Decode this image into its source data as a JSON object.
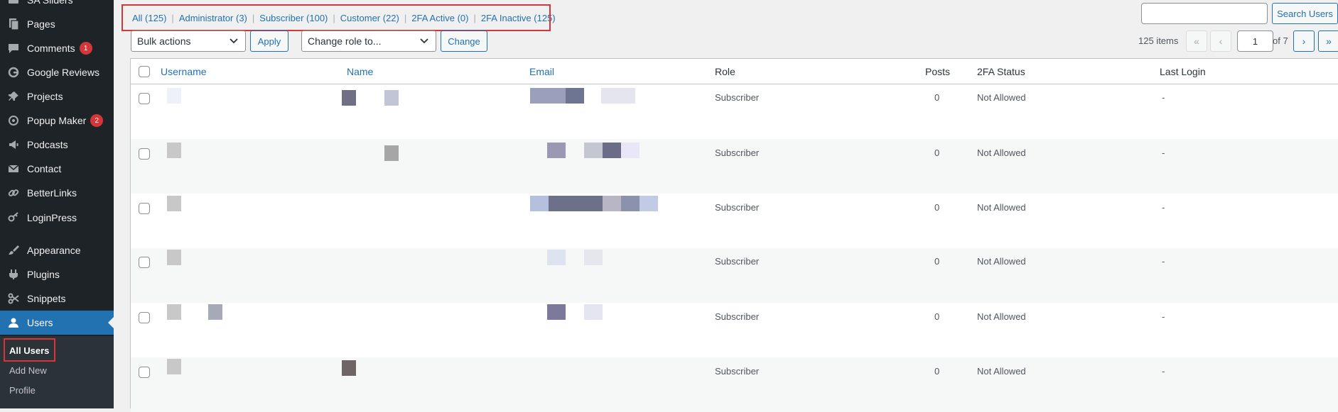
{
  "colors": {
    "sidebar_bg": "#1d2327",
    "accent": "#2271b1",
    "badge": "#d63638",
    "highlight_box": "#d63638"
  },
  "sidebar": {
    "items": [
      {
        "label": "SA Sliders",
        "icon": "slides-icon"
      },
      {
        "label": "Pages",
        "icon": "page-icon"
      },
      {
        "label": "Comments",
        "icon": "comment-icon",
        "badge": "1"
      },
      {
        "label": "Google Reviews",
        "icon": "google-icon"
      },
      {
        "label": "Projects",
        "icon": "pin-icon"
      },
      {
        "label": "Popup Maker",
        "icon": "popup-icon",
        "badge": "2"
      },
      {
        "label": "Podcasts",
        "icon": "megaphone-icon"
      },
      {
        "label": "Contact",
        "icon": "mail-icon"
      },
      {
        "label": "BetterLinks",
        "icon": "link-icon"
      },
      {
        "label": "LoginPress",
        "icon": "key-icon"
      },
      {
        "label": "Appearance",
        "icon": "brush-icon"
      },
      {
        "label": "Plugins",
        "icon": "plug-icon"
      },
      {
        "label": "Snippets",
        "icon": "scissors-icon"
      },
      {
        "label": "Users",
        "icon": "user-icon",
        "active": true
      }
    ],
    "submenu": [
      {
        "label": "All Users",
        "current": true
      },
      {
        "label": "Add New"
      },
      {
        "label": "Profile"
      }
    ]
  },
  "filters": [
    {
      "label": "All (125)"
    },
    {
      "label": "Administrator (3)"
    },
    {
      "label": "Subscriber (100)"
    },
    {
      "label": "Customer (22)"
    },
    {
      "label": "2FA Active (0)"
    },
    {
      "label": "2FA Inactive (125)"
    }
  ],
  "search": {
    "value": "",
    "button": "Search Users"
  },
  "bulk": {
    "selected": "Bulk actions",
    "apply": "Apply"
  },
  "role": {
    "selected": "Change role to...",
    "change": "Change"
  },
  "pagination": {
    "count": "125 items",
    "first": "«",
    "prev": "‹",
    "current": "1",
    "of": "of 7",
    "next": "›",
    "last": "»"
  },
  "table": {
    "columns": [
      "Username",
      "Name",
      "Email",
      "Role",
      "Posts",
      "2FA Status",
      "Last Login"
    ],
    "rows": [
      {
        "role": "Subscriber",
        "posts": "0",
        "tfa": "Not Allowed",
        "last_login": "-"
      },
      {
        "role": "Subscriber",
        "posts": "0",
        "tfa": "Not Allowed",
        "last_login": "-"
      },
      {
        "role": "Subscriber",
        "posts": "0",
        "tfa": "Not Allowed",
        "last_login": "-"
      },
      {
        "role": "Subscriber",
        "posts": "0",
        "tfa": "Not Allowed",
        "last_login": "-"
      },
      {
        "role": "Subscriber",
        "posts": "0",
        "tfa": "Not Allowed",
        "last_login": "-"
      },
      {
        "role": "Subscriber",
        "posts": "0",
        "tfa": "Not Allowed",
        "last_login": "-"
      }
    ]
  }
}
